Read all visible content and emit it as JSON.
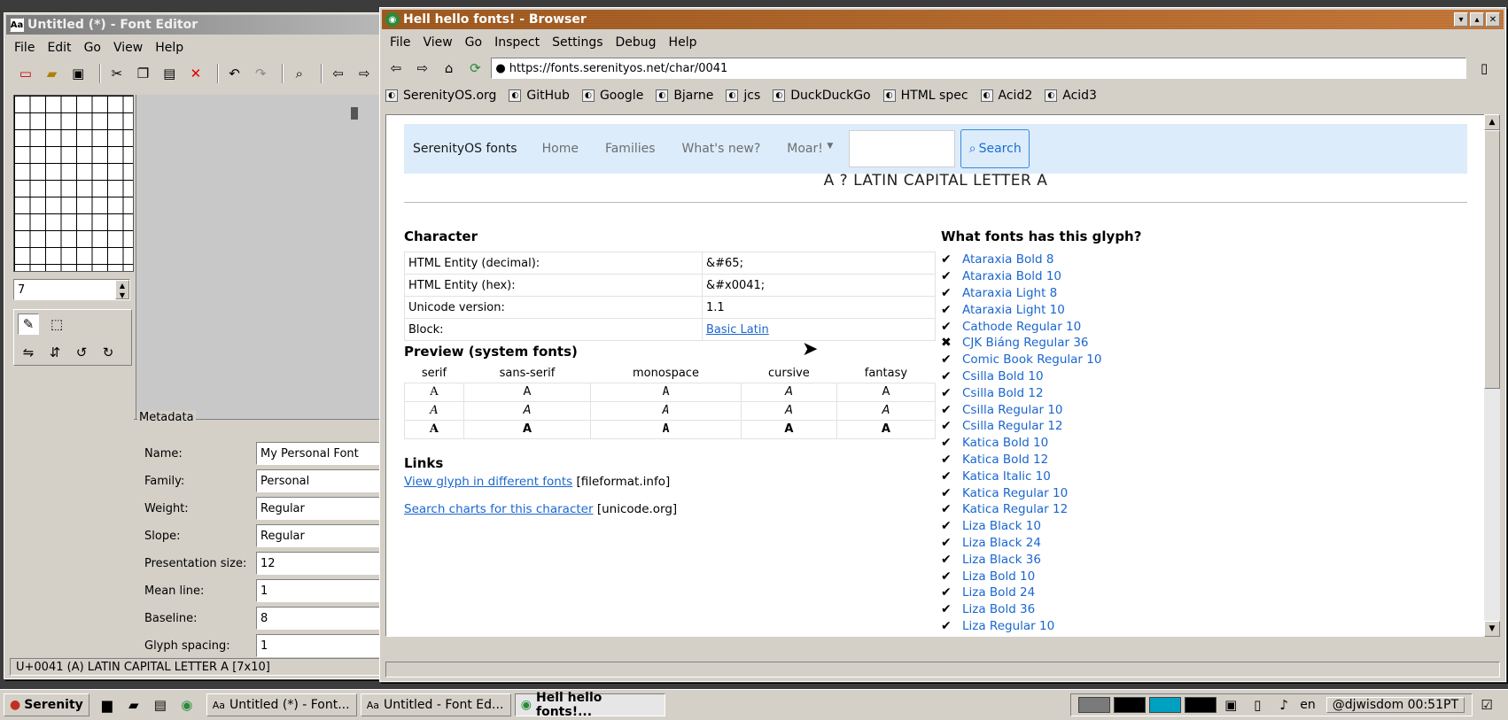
{
  "font_editor": {
    "title": "Untitled (*) - Font Editor",
    "menu": [
      "File",
      "Edit",
      "Go",
      "View",
      "Help"
    ],
    "glyph_width_value": "7",
    "metadata_title": "Metadata",
    "fields": [
      {
        "label": "Name:",
        "value": "My Personal Font"
      },
      {
        "label": "Family:",
        "value": "Personal"
      },
      {
        "label": "Weight:",
        "value": "Regular"
      },
      {
        "label": "Slope:",
        "value": "Regular"
      },
      {
        "label": "Presentation size:",
        "value": "12"
      },
      {
        "label": "Mean line:",
        "value": "1"
      },
      {
        "label": "Baseline:",
        "value": "8"
      },
      {
        "label": "Glyph spacing:",
        "value": "1"
      }
    ],
    "status": "U+0041 (A) LATIN CAPITAL LETTER A [7x10]"
  },
  "browser": {
    "title": "Hell hello fonts! - Browser",
    "menu": [
      "File",
      "View",
      "Go",
      "Inspect",
      "Settings",
      "Debug",
      "Help"
    ],
    "url": "https://fonts.serenityos.net/char/0041",
    "bookmarks": [
      "SerenityOS.org",
      "GitHub",
      "Google",
      "Bjarne",
      "jcs",
      "DuckDuckGo",
      "HTML spec",
      "Acid2",
      "Acid3"
    ]
  },
  "page": {
    "brand": "SerenityOS fonts",
    "nav": [
      "Home",
      "Families",
      "What's new?",
      "Moar!"
    ],
    "search_label": "Search",
    "heading": "A ?  LATIN CAPITAL LETTER A",
    "character_heading": "Character",
    "info_rows": [
      {
        "key": "HTML Entity (decimal):",
        "value": "&#65;"
      },
      {
        "key": "HTML Entity (hex):",
        "value": "&#x0041;"
      },
      {
        "key": "Unicode version:",
        "value": "1.1"
      },
      {
        "key": "Block:",
        "value": "Basic Latin"
      }
    ],
    "preview_heading": "Preview (system fonts)",
    "preview_columns": [
      "serif",
      "sans-serif",
      "monospace",
      "cursive",
      "fantasy"
    ],
    "preview_glyph": "A",
    "links_heading": "Links",
    "links": [
      {
        "text": "View glyph in different fonts",
        "source": "[fileformat.info]"
      },
      {
        "text": "Search charts for this character",
        "source": "[unicode.org]"
      }
    ],
    "fonts_heading": "What fonts has this glyph?",
    "fonts": [
      {
        "name": "Ataraxia Bold 8",
        "has": true
      },
      {
        "name": "Ataraxia Bold 10",
        "has": true
      },
      {
        "name": "Ataraxia Light 8",
        "has": true
      },
      {
        "name": "Ataraxia Light 10",
        "has": true
      },
      {
        "name": "Cathode Regular 10",
        "has": true
      },
      {
        "name": "CJK Biáng Regular 36",
        "has": false
      },
      {
        "name": "Comic Book Regular 10",
        "has": true
      },
      {
        "name": "Csilla Bold 10",
        "has": true
      },
      {
        "name": "Csilla Bold 12",
        "has": true
      },
      {
        "name": "Csilla Regular 10",
        "has": true
      },
      {
        "name": "Csilla Regular 12",
        "has": true
      },
      {
        "name": "Katica Bold 10",
        "has": true
      },
      {
        "name": "Katica Bold 12",
        "has": true
      },
      {
        "name": "Katica Italic 10",
        "has": true
      },
      {
        "name": "Katica Regular 10",
        "has": true
      },
      {
        "name": "Katica Regular 12",
        "has": true
      },
      {
        "name": "Liza Black 10",
        "has": true
      },
      {
        "name": "Liza Black 24",
        "has": true
      },
      {
        "name": "Liza Black 36",
        "has": true
      },
      {
        "name": "Liza Bold 10",
        "has": true
      },
      {
        "name": "Liza Bold 24",
        "has": true
      },
      {
        "name": "Liza Bold 36",
        "has": true
      },
      {
        "name": "Liza Regular 10",
        "has": true
      }
    ]
  },
  "taskbar": {
    "start": "Serenity",
    "tasks": [
      "Untitled (*) - Font...",
      "Untitled - Font Ed...",
      "Hell hello fonts!..."
    ],
    "lang": "en",
    "clock": "@djwisdom 00:51PT"
  }
}
